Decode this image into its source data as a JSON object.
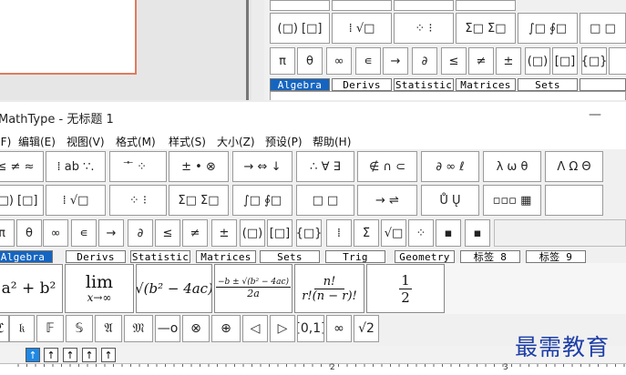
{
  "bg_window": {
    "row1": [
      "",
      "",
      "",
      ""
    ],
    "row2": [
      "(□) [□]",
      "⁞ √□",
      "⁘ ⁝",
      "Σ□ Σ□",
      "∫□ ∮□",
      "□ □"
    ],
    "row3": [
      "π",
      "θ",
      "∞",
      "∊",
      "→",
      "∂",
      "≤",
      "≠",
      "±",
      "(□)",
      "[□]",
      "{□}",
      ""
    ],
    "tabs": [
      "Algebra",
      "Derivs",
      "Statistic",
      "Matrices",
      "Sets",
      ""
    ]
  },
  "window": {
    "title": "MathType - 无标题 1",
    "minimize": "—"
  },
  "menu": [
    "文件(F)",
    "编辑(E)",
    "视图(V)",
    "格式(M)",
    "样式(S)",
    "大小(Z)",
    "预设(P)",
    "帮助(H)"
  ],
  "palette_row1": [
    "≤ ≠ ≈",
    "⁞ ab ∵.",
    "⃗ ⃖ ⁘",
    "± • ⊗",
    "→ ⇔ ↓",
    "∴ ∀ ∃",
    "∉ ∩ ⊂",
    "∂ ∞ ℓ",
    "λ ω θ",
    "Λ Ω Θ"
  ],
  "palette_row2": [
    "(□) [□]",
    "⁞ √□",
    "⁘ ⁝",
    "Σ□ Σ□",
    "∫□ ∮□",
    "□ □",
    "→ ⇌",
    "Ů Ų",
    "▫▫▫ ▦"
  ],
  "palette_row3": [
    "π",
    "θ",
    "∞",
    "∊",
    "→",
    "∂",
    "≤",
    "≠",
    "±",
    "(□)",
    "[□]",
    "{□}",
    "⁞",
    "Σ̈",
    "√□",
    "⁘",
    "▪",
    "▪"
  ],
  "tabs": [
    "Algebra",
    "Derivs",
    "Statistic",
    "Matrices",
    "Sets",
    "Trig",
    "Geometry",
    "标签 8",
    "标签 9"
  ],
  "templates": {
    "t1": "a² + b²",
    "t2_top": "lim",
    "t2_bottom": "x→∞",
    "t3": "√(b² − 4ac)",
    "t4_num": "−b ± √(b² − 4ac)",
    "t4_den": "2a",
    "t5_num": "n!",
    "t5_den": "r!(n − r)!",
    "t6_num": "1",
    "t6_den": "2"
  },
  "small_row": [
    "ℭ",
    "𝔨",
    "𝔽",
    "𝕊",
    "𝔄",
    "𝔐",
    "—o",
    "⊗",
    "⊕",
    "◁",
    "▷",
    "[0,1]",
    "∞",
    "√2"
  ],
  "nav_buttons": [
    "↑",
    "↑",
    "↑",
    "↑",
    "↑"
  ],
  "ruler": {
    "mark2": "2",
    "mark3": "3"
  },
  "watermark": "最需教育"
}
